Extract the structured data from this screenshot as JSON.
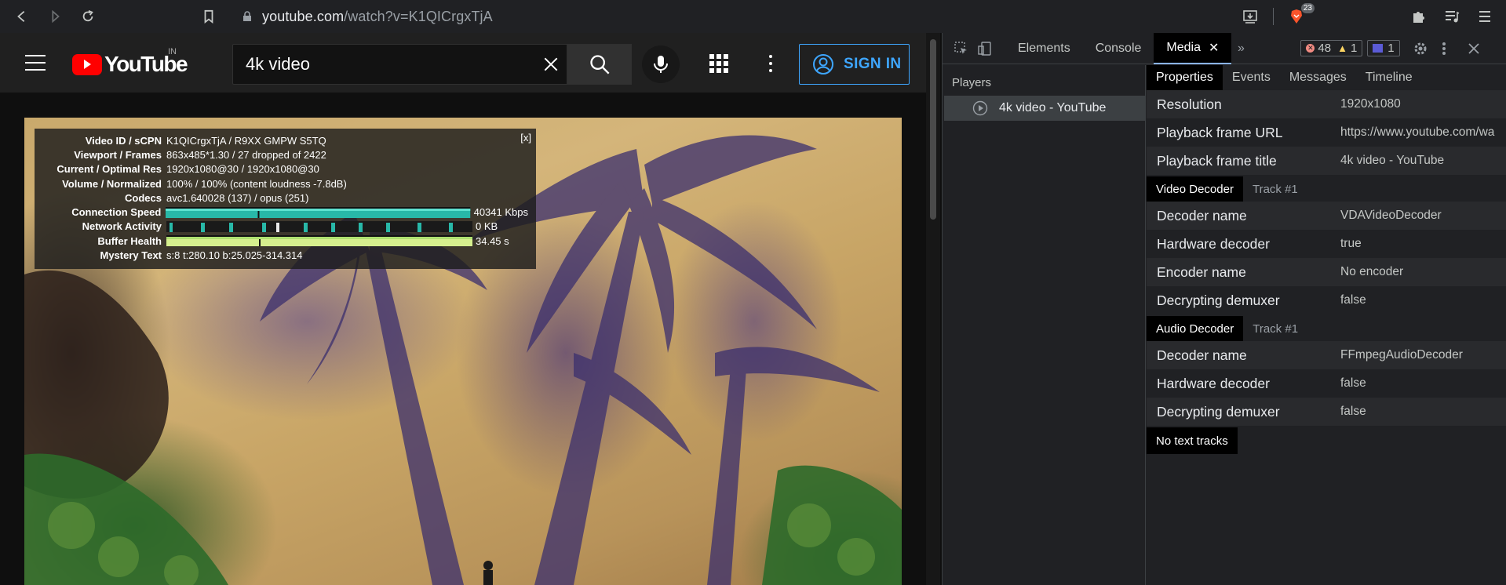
{
  "browser": {
    "url_domain": "youtube.com",
    "url_path": "/watch?v=K1QICrgxTjA",
    "brave_badge_count": "23"
  },
  "youtube": {
    "logo_text": "YouTube",
    "country_code": "IN",
    "search_value": "4k video",
    "signin_label": "SIGN IN"
  },
  "stats": {
    "close_label": "[x]",
    "rows": [
      {
        "key": "Video ID / sCPN",
        "value": "K1QICrgxTjA / R9XX GMPW S5TQ"
      },
      {
        "key": "Viewport / Frames",
        "value": "863x485*1.30 / 27 dropped of 2422"
      },
      {
        "key": "Current / Optimal Res",
        "value": "1920x1080@30 / 1920x1080@30"
      },
      {
        "key": "Volume / Normalized",
        "value": "100% / 100% (content loudness -7.8dB)"
      },
      {
        "key": "Codecs",
        "value": "avc1.640028 (137) / opus (251)"
      }
    ],
    "connection_label": "Connection Speed",
    "connection_value": "40341 Kbps",
    "network_label": "Network Activity",
    "network_value": "0 KB",
    "buffer_label": "Buffer Health",
    "buffer_value": "34.45 s",
    "mystery_label": "Mystery Text",
    "mystery_value": "s:8 t:280.10 b:25.025-314.314"
  },
  "devtools": {
    "tabs": {
      "elements": "Elements",
      "console": "Console",
      "media": "Media"
    },
    "error_count": "48",
    "warning_count": "1",
    "message_count": "1",
    "players_title": "Players",
    "player_item": "4k video - YouTube",
    "subtabs": {
      "properties": "Properties",
      "events": "Events",
      "messages": "Messages",
      "timeline": "Timeline"
    },
    "general_props": [
      {
        "key": "Resolution",
        "value": "1920x1080"
      },
      {
        "key": "Playback frame URL",
        "value": "https://www.youtube.com/wa"
      },
      {
        "key": "Playback frame title",
        "value": "4k video - YouTube"
      }
    ],
    "video_decoder_label": "Video Decoder",
    "video_track_label": "Track #1",
    "video_props": [
      {
        "key": "Decoder name",
        "value": "VDAVideoDecoder"
      },
      {
        "key": "Hardware decoder",
        "value": "true"
      },
      {
        "key": "Encoder name",
        "value": "No encoder"
      },
      {
        "key": "Decrypting demuxer",
        "value": "false"
      }
    ],
    "audio_decoder_label": "Audio Decoder",
    "audio_track_label": "Track #1",
    "audio_props": [
      {
        "key": "Decoder name",
        "value": "FFmpegAudioDecoder"
      },
      {
        "key": "Hardware decoder",
        "value": "false"
      },
      {
        "key": "Decrypting demuxer",
        "value": "false"
      }
    ],
    "no_text_tracks": "No text tracks"
  }
}
